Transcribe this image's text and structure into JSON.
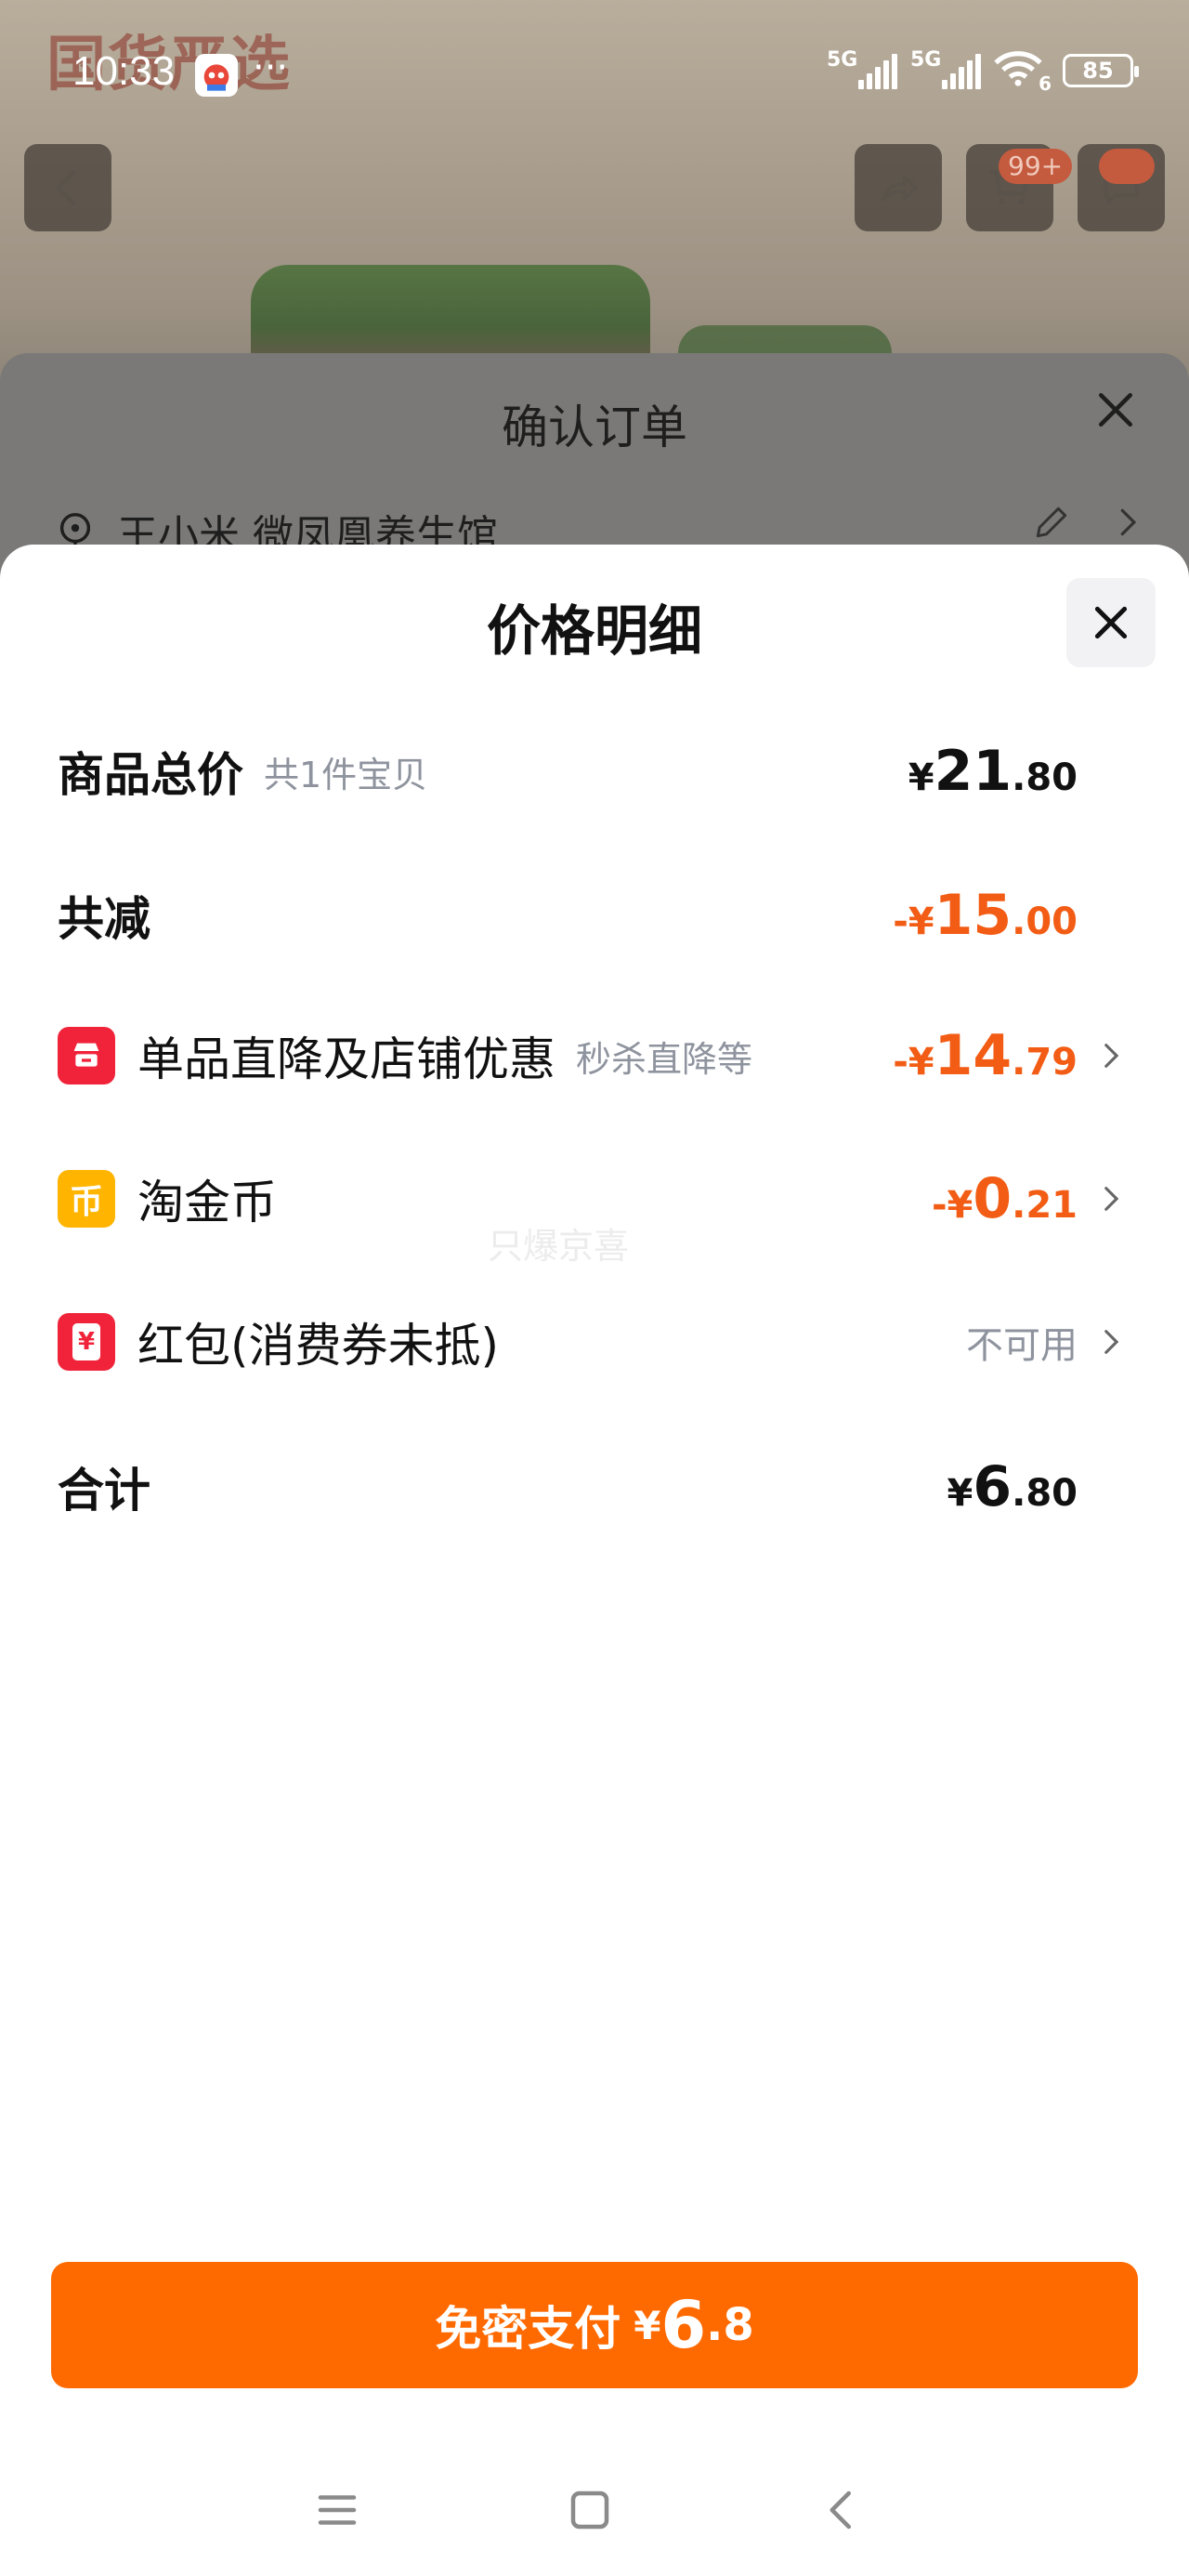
{
  "status_bar": {
    "time": "10:33",
    "more": "···",
    "signal1_label": "5G",
    "signal2_label": "5G",
    "wifi_label": "6",
    "battery": "85"
  },
  "background": {
    "brand": "国货严选",
    "cart_badge": "99+"
  },
  "confirm_sheet": {
    "title": "确认订单",
    "address": "王小米 微凤凰养生馆"
  },
  "price_detail": {
    "title": "价格明细",
    "rows": [
      {
        "label": "商品总价",
        "sub": "共1件宝贝",
        "sign": "",
        "symbol": "¥",
        "int": "21",
        "dec": ".80"
      },
      {
        "label": "共减",
        "sub": "",
        "sign": "-",
        "symbol": "¥",
        "int": "15",
        "dec": ".00"
      },
      {
        "label": "单品直降及店铺优惠",
        "sub": "秒杀直降等",
        "sign": "-",
        "symbol": "¥",
        "int": "14",
        "dec": ".79",
        "icon": "store-icon",
        "icon_char": ""
      },
      {
        "label": "淘金币",
        "sub": "",
        "sign": "-",
        "symbol": "¥",
        "int": "0",
        "dec": ".21",
        "icon": "coin-icon",
        "icon_char": "币"
      },
      {
        "label": "红包(消费券未抵)",
        "sub": "",
        "status": "不可用",
        "icon": "red-packet-icon",
        "icon_char": "¥"
      },
      {
        "label": "合计",
        "sub": "",
        "sign": "",
        "symbol": "¥",
        "int": "6",
        "dec": ".80"
      }
    ],
    "watermark": "只爆京喜"
  },
  "pay_button": {
    "label": "免密支付",
    "symbol": "¥",
    "int": "6",
    "dec": ".8"
  },
  "colors": {
    "accent": "#ff6a00",
    "discount": "#f25c14",
    "store_icon_bg": "#f0233a",
    "coin_icon_bg": "#ffb400",
    "packet_icon_bg": "#f0233a"
  }
}
